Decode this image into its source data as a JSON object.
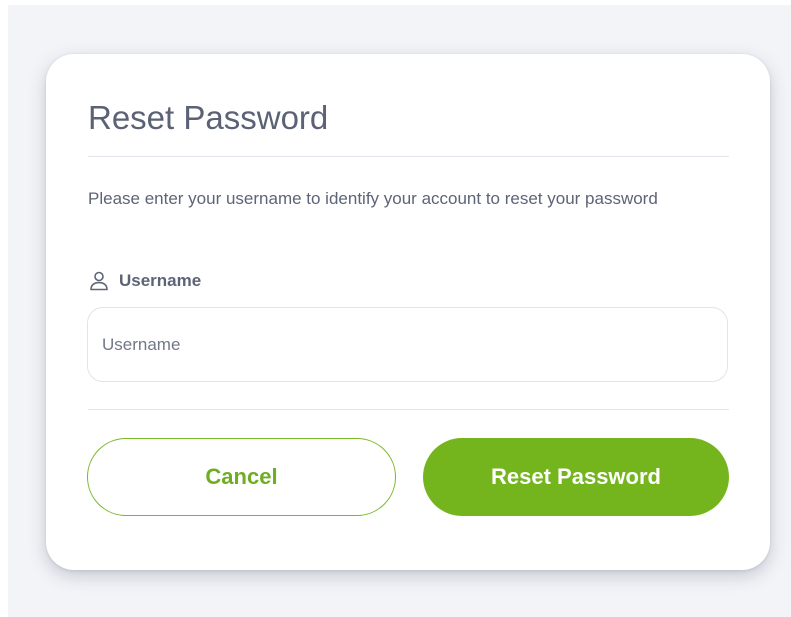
{
  "dialog": {
    "title": "Reset Password",
    "instructions": "Please enter your username to identify your account to reset your password",
    "username_field": {
      "label": "Username",
      "icon": "user-icon",
      "placeholder": "Username",
      "value": ""
    },
    "actions": {
      "cancel_label": "Cancel",
      "submit_label": "Reset Password"
    }
  },
  "colors": {
    "accent": "#74b51e",
    "text": "#5d6476",
    "background": "#f3f4f8"
  }
}
